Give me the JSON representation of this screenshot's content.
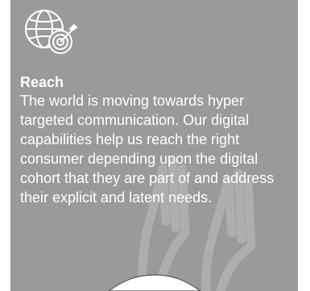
{
  "card": {
    "title": "Reach",
    "body": "The world is moving towards hyper targeted communication. Our digital capabilities help us reach the right consumer depending upon the digital cohort that they are part of and address their explicit and latent needs."
  },
  "icons": {
    "feature": "globe-target-icon",
    "watermark": "raised-hands-icon"
  },
  "colors": {
    "card_background": "#9a9a9a",
    "text": "#ffffff"
  }
}
